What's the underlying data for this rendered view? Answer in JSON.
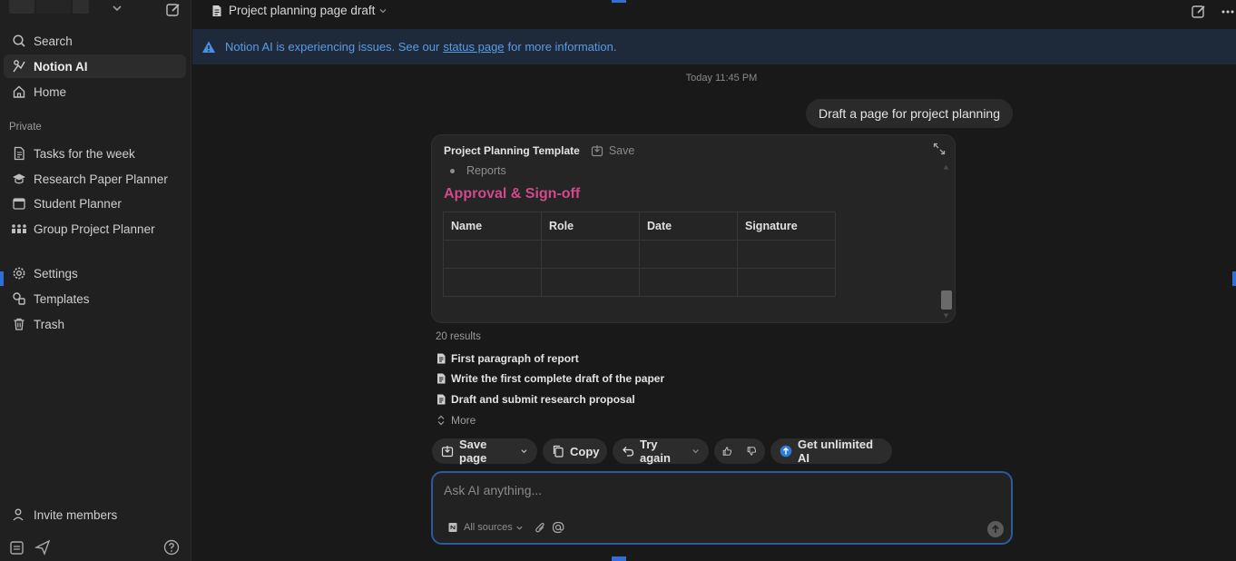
{
  "sidebar": {
    "nav": [
      {
        "id": "search",
        "label": "Search",
        "icon": "search-icon"
      },
      {
        "id": "notion-ai",
        "label": "Notion AI",
        "icon": "notion-ai-icon"
      },
      {
        "id": "home",
        "label": "Home",
        "icon": "home-icon"
      }
    ],
    "section_label": "Private",
    "pages": [
      {
        "label": "Tasks for the week",
        "icon": "page-icon"
      },
      {
        "label": "Research Paper Planner",
        "icon": "graduation-cap-icon"
      },
      {
        "label": "Student Planner",
        "icon": "calendar-icon"
      },
      {
        "label": "Group Project Planner",
        "icon": "people-icon"
      }
    ],
    "utilities": [
      {
        "label": "Settings",
        "icon": "gear-icon"
      },
      {
        "label": "Templates",
        "icon": "templates-icon"
      },
      {
        "label": "Trash",
        "icon": "trash-icon"
      }
    ],
    "invite_label": "Invite members"
  },
  "topbar": {
    "page_title": "Project planning page draft"
  },
  "banner": {
    "text_before": "Notion AI is experiencing issues. See our",
    "link_text": "status page",
    "text_after": "for more information."
  },
  "chat": {
    "timestamp": "Today 11:45 PM",
    "user_message": "Draft a page for project planning"
  },
  "preview": {
    "title": "Project Planning Template",
    "save_label": "Save",
    "bullet": "Reports",
    "heading": "Approval & Sign-off",
    "table_headers": [
      "Name",
      "Role",
      "Date",
      "Signature"
    ],
    "table_rows": [
      [
        "",
        "",
        "",
        ""
      ],
      [
        "",
        "",
        "",
        ""
      ]
    ]
  },
  "results": {
    "count_label": "20 results",
    "items": [
      "First paragraph of report",
      "Write the first complete draft of the paper",
      "Draft and submit research proposal"
    ],
    "more_label": "More"
  },
  "actions": {
    "save_page": "Save page",
    "copy": "Copy",
    "try_again": "Try again",
    "get_unlimited": "Get unlimited AI"
  },
  "ask": {
    "placeholder": "Ask AI anything...",
    "sources_label": "All sources"
  },
  "colors": {
    "accent_blue": "#2d5a9c",
    "heading_pink": "#d1498a",
    "banner_text": "#5a9be6"
  }
}
